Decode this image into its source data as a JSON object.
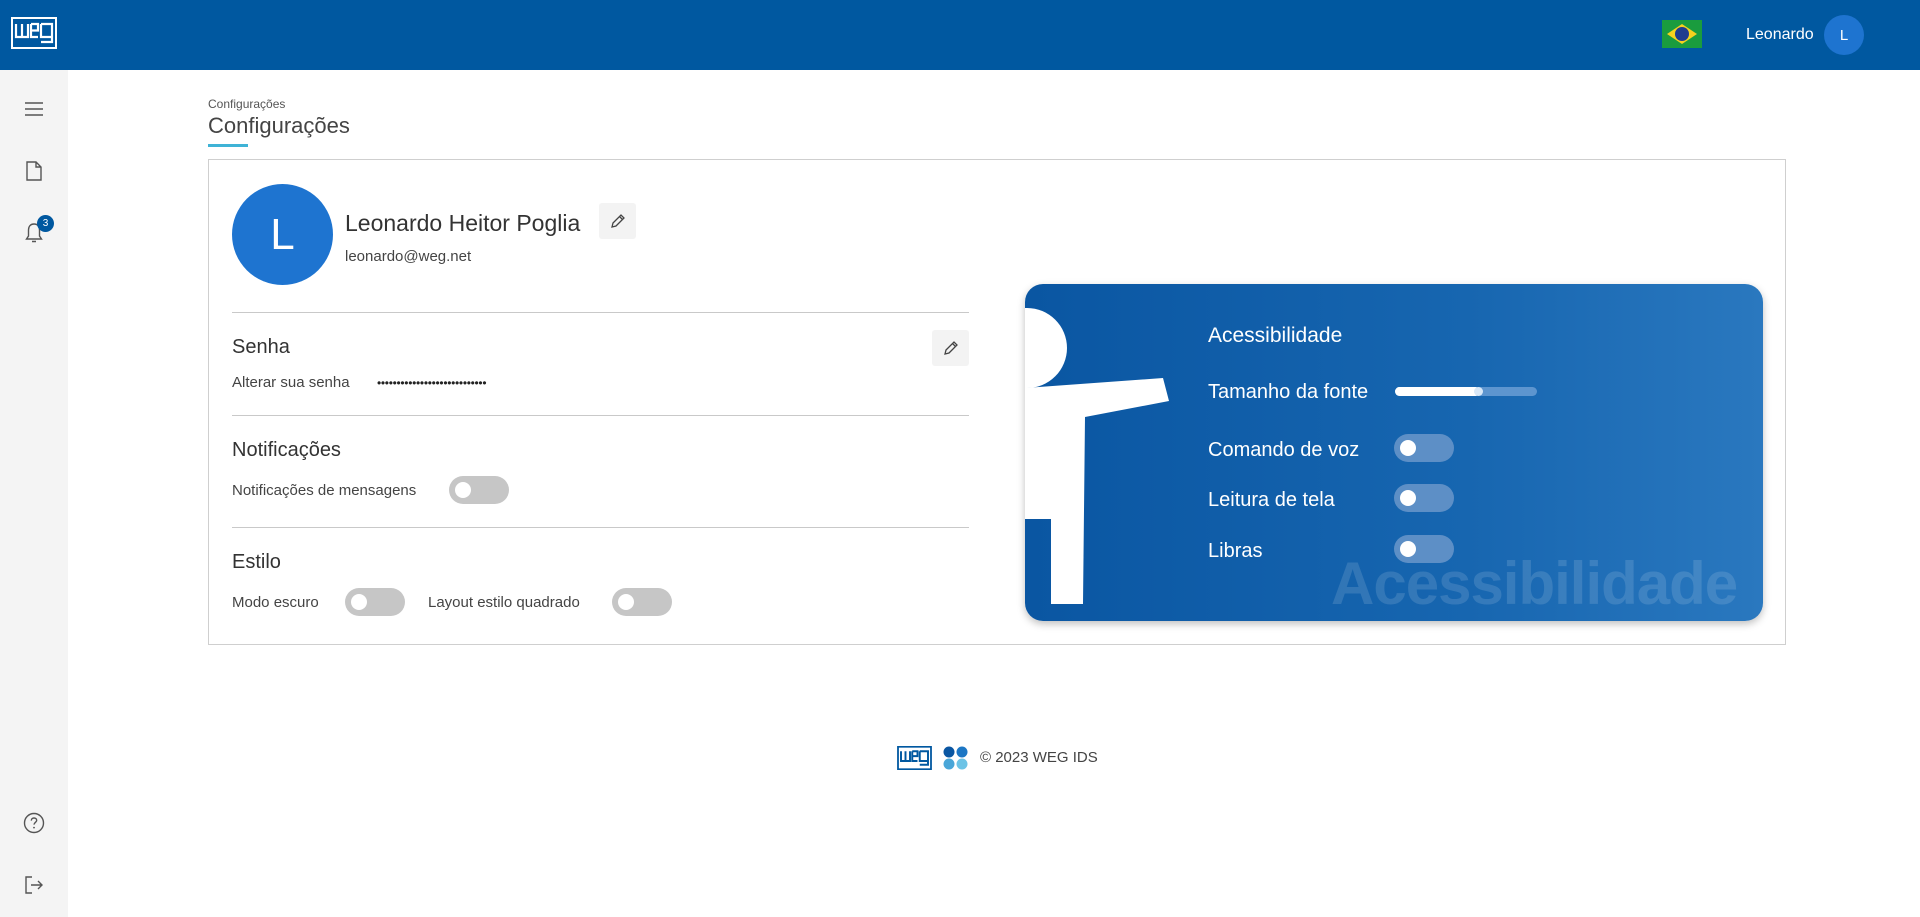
{
  "header": {
    "logo": "WEG",
    "flag_icon": "brazil-flag-icon",
    "user_name": "Leonardo",
    "user_initial": "L",
    "brand_color": "#0058a0"
  },
  "sidebar": {
    "items": [
      {
        "icon": "menu-icon"
      },
      {
        "icon": "document-icon"
      },
      {
        "icon": "bell-icon",
        "badge": "3"
      },
      {
        "icon": "help-icon"
      },
      {
        "icon": "logout-icon"
      }
    ]
  },
  "breadcrumb": "Configurações",
  "page_title": "Configurações",
  "profile": {
    "initial": "L",
    "full_name": "Leonardo Heitor Poglia",
    "email": "leonardo@weg.net"
  },
  "password": {
    "title": "Senha",
    "label": "Alterar sua senha",
    "masked": "••••••••••••••••••••••••••••"
  },
  "notifications": {
    "title": "Notificações",
    "messages_label": "Notificações de mensagens",
    "messages_on": false
  },
  "style": {
    "title": "Estilo",
    "dark_mode_label": "Modo escuro",
    "dark_mode_on": false,
    "square_layout_label": "Layout estilo quadrado",
    "square_layout_on": false
  },
  "accessibility": {
    "title": "Acessibilidade",
    "watermark": "Acessibilidade",
    "font_size_label": "Tamanho da fonte",
    "font_size_level": 0.6,
    "voice_command_label": "Comando de voz",
    "voice_command_on": false,
    "screen_reader_label": "Leitura de tela",
    "screen_reader_on": false,
    "libras_label": "Libras",
    "libras_on": false
  },
  "footer": {
    "copyright": "© 2023 WEG IDS"
  }
}
